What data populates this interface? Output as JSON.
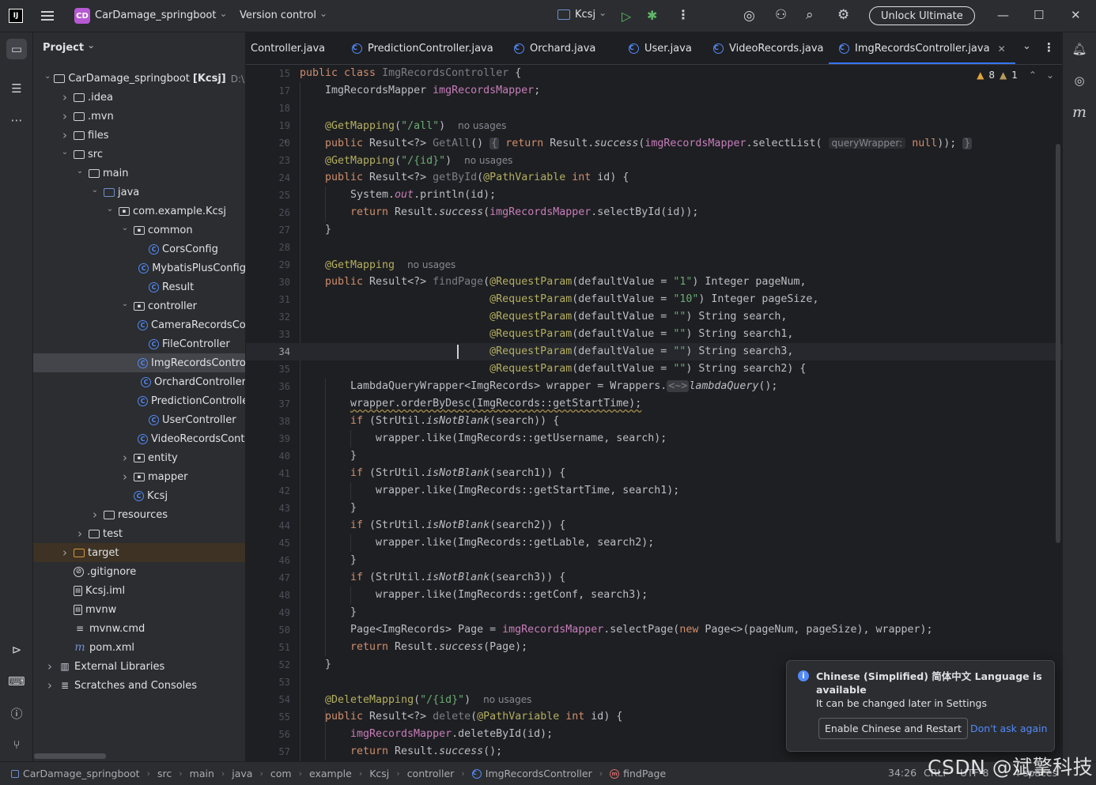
{
  "titlebar": {
    "logo": "IJ",
    "project_badge": "CD",
    "project_name": "CarDamage_springboot",
    "version_control": "Version control",
    "run_config": "Kcsj",
    "unlock": "Unlock Ultimate"
  },
  "project_panel": {
    "title": "Project",
    "tree": [
      {
        "label": "CarDamage_springboot",
        "suffix": "[Kcsj]",
        "hint": "D:\\未知",
        "depth": 0,
        "arrow": "open",
        "icon": "folder"
      },
      {
        "label": ".idea",
        "depth": 1,
        "arrow": "closed",
        "icon": "folder"
      },
      {
        "label": ".mvn",
        "depth": 1,
        "arrow": "closed",
        "icon": "folder"
      },
      {
        "label": "files",
        "depth": 1,
        "arrow": "closed",
        "icon": "folder"
      },
      {
        "label": "src",
        "depth": 1,
        "arrow": "open",
        "icon": "folder"
      },
      {
        "label": "main",
        "depth": 2,
        "arrow": "open",
        "icon": "folder"
      },
      {
        "label": "java",
        "depth": 3,
        "arrow": "open",
        "icon": "folder-blue"
      },
      {
        "label": "com.example.Kcsj",
        "depth": 4,
        "arrow": "open",
        "icon": "pkg"
      },
      {
        "label": "common",
        "depth": 5,
        "arrow": "open",
        "icon": "pkg"
      },
      {
        "label": "CorsConfig",
        "depth": 6,
        "arrow": "none",
        "icon": "cls"
      },
      {
        "label": "MybatisPlusConfig",
        "depth": 6,
        "arrow": "none",
        "icon": "cls"
      },
      {
        "label": "Result",
        "depth": 6,
        "arrow": "none",
        "icon": "cls"
      },
      {
        "label": "controller",
        "depth": 5,
        "arrow": "open",
        "icon": "pkg"
      },
      {
        "label": "CameraRecordsController",
        "depth": 6,
        "arrow": "none",
        "icon": "cls"
      },
      {
        "label": "FileController",
        "depth": 6,
        "arrow": "none",
        "icon": "cls"
      },
      {
        "label": "ImgRecordsController",
        "depth": 6,
        "arrow": "none",
        "icon": "cls",
        "selected": true
      },
      {
        "label": "OrchardController",
        "depth": 6,
        "arrow": "none",
        "icon": "cls"
      },
      {
        "label": "PredictionController",
        "depth": 6,
        "arrow": "none",
        "icon": "cls"
      },
      {
        "label": "UserController",
        "depth": 6,
        "arrow": "none",
        "icon": "cls"
      },
      {
        "label": "VideoRecordsController",
        "depth": 6,
        "arrow": "none",
        "icon": "cls"
      },
      {
        "label": "entity",
        "depth": 5,
        "arrow": "closed",
        "icon": "pkg"
      },
      {
        "label": "mapper",
        "depth": 5,
        "arrow": "closed",
        "icon": "pkg"
      },
      {
        "label": "Kcsj",
        "depth": 5,
        "arrow": "none",
        "icon": "cls"
      },
      {
        "label": "resources",
        "depth": 3,
        "arrow": "closed",
        "icon": "folder"
      },
      {
        "label": "test",
        "depth": 2,
        "arrow": "closed",
        "icon": "folder"
      },
      {
        "label": "target",
        "depth": 1,
        "arrow": "closed",
        "icon": "folder-orange",
        "excluded": true
      },
      {
        "label": ".gitignore",
        "depth": 1,
        "arrow": "none",
        "icon": "ignore"
      },
      {
        "label": "Kcsj.iml",
        "depth": 1,
        "arrow": "none",
        "icon": "file"
      },
      {
        "label": "mvnw",
        "depth": 1,
        "arrow": "none",
        "icon": "file"
      },
      {
        "label": "mvnw.cmd",
        "depth": 1,
        "arrow": "none",
        "icon": "text"
      },
      {
        "label": "pom.xml",
        "depth": 1,
        "arrow": "none",
        "icon": "maven"
      },
      {
        "label": "External Libraries",
        "depth": 0,
        "arrow": "closed",
        "icon": "lib"
      },
      {
        "label": "Scratches and Consoles",
        "depth": 0,
        "arrow": "closed",
        "icon": "scratch"
      }
    ]
  },
  "tabs": [
    {
      "label": "Controller.java",
      "icon": false
    },
    {
      "label": "PredictionController.java",
      "icon": true
    },
    {
      "label": "Orchard.java",
      "icon": true
    },
    {
      "label": "User.java",
      "icon": true
    },
    {
      "label": "VideoRecords.java",
      "icon": true
    },
    {
      "label": "ImgRecordsController.java",
      "icon": true,
      "active": true
    }
  ],
  "inspections": {
    "warnings": "8",
    "weak_warnings": "1"
  },
  "editor": {
    "current_line": "34",
    "lines": [
      {
        "n": "15",
        "html": "<span class=\"kw\">public class</span> <span class=\"unused\">ImgRecordsController</span> {",
        "indent": 0
      },
      {
        "n": "17",
        "html": "ImgRecordsMapper <span class=\"fld\">imgRecordsMapper</span>;",
        "indent": 1
      },
      {
        "n": "18",
        "html": "",
        "indent": 0
      },
      {
        "n": "19",
        "html": "<span class=\"ann\">@GetMapping</span>(<span class=\"str\">\"/all\"</span>)  <span class=\"hint\">no usages</span>",
        "indent": 1
      },
      {
        "n": "20",
        "html": "<span class=\"kw\">public</span> Result&lt;?&gt; <span class=\"unused\">GetAll</span>() <span class=\"fold-box\">{</span> <span class=\"kw\">return</span> Result.<span class=\"it\">success</span>(<span class=\"fld\">imgRecordsMapper</span>.selectList( <span class=\"inlay\">queryWrapper:</span> <span class=\"kw\">null</span>)); <span class=\"fold-box\">}</span>",
        "indent": 1,
        "fold": true
      },
      {
        "n": "23",
        "html": "<span class=\"ann\">@GetMapping</span>(<span class=\"str\">\"/{id}\"</span>)  <span class=\"hint\">no usages</span>",
        "indent": 1
      },
      {
        "n": "24",
        "html": "<span class=\"kw\">public</span> Result&lt;?&gt; <span class=\"unused\">getById</span>(<span class=\"ann\">@PathVariable</span> <span class=\"kw\">int</span> id) {",
        "indent": 1
      },
      {
        "n": "25",
        "html": "System.<span class=\"fld it\">out</span>.println(id);",
        "indent": 2
      },
      {
        "n": "26",
        "html": "<span class=\"kw\">return</span> Result.<span class=\"it\">success</span>(<span class=\"fld\">imgRecordsMapper</span>.selectById(id));",
        "indent": 2
      },
      {
        "n": "27",
        "html": "}",
        "indent": 1
      },
      {
        "n": "28",
        "html": "",
        "indent": 0
      },
      {
        "n": "29",
        "html": "<span class=\"ann\">@GetMapping</span>  <span class=\"hint\">no usages</span>",
        "indent": 1
      },
      {
        "n": "30",
        "html": "<span class=\"kw\">public</span> Result&lt;?&gt; <span class=\"unused\">findPage</span>(<span class=\"ann\">@RequestParam</span>(defaultValue = <span class=\"str\">\"1\"</span>) Integer pageNum,",
        "indent": 1
      },
      {
        "n": "31",
        "html": "                          <span class=\"ann\">@RequestParam</span>(defaultValue = <span class=\"str\">\"10\"</span>) Integer pageSize,",
        "indent": 1
      },
      {
        "n": "32",
        "html": "                          <span class=\"ann\">@RequestParam</span>(defaultValue = <span class=\"str\">\"\"</span>) String search,",
        "indent": 1
      },
      {
        "n": "33",
        "html": "                          <span class=\"ann\">@RequestParam</span>(defaultValue = <span class=\"str\">\"\"</span>) String search1,",
        "indent": 1
      },
      {
        "n": "34",
        "html": "                          <span class=\"ann\">@RequestParam</span>(defaultValue = <span class=\"str\">\"\"</span>) String search3,",
        "indent": 1
      },
      {
        "n": "35",
        "html": "                          <span class=\"ann\">@RequestParam</span>(defaultValue = <span class=\"str\">\"\"</span>) String search2) {",
        "indent": 1
      },
      {
        "n": "36",
        "html": "LambdaQueryWrapper&lt;ImgRecords&gt; wrapper = Wrappers.<span class=\"fold-box\">&lt;~&gt;</span><span class=\"it\">lambdaQuery</span>();",
        "indent": 2
      },
      {
        "n": "37",
        "html": "<span class=\"wavy\">wrapper.orderByDesc(ImgRecords::getStartTime);</span>",
        "indent": 2
      },
      {
        "n": "38",
        "html": "<span class=\"kw\">if</span> (StrUtil.<span class=\"it\">isNotBlank</span>(search)) {",
        "indent": 2
      },
      {
        "n": "39",
        "html": "wrapper.like(ImgRecords::getUsername, search);",
        "indent": 3
      },
      {
        "n": "40",
        "html": "}",
        "indent": 2
      },
      {
        "n": "41",
        "html": "<span class=\"kw\">if</span> (StrUtil.<span class=\"it\">isNotBlank</span>(search1)) {",
        "indent": 2
      },
      {
        "n": "42",
        "html": "wrapper.like(ImgRecords::getStartTime, search1);",
        "indent": 3
      },
      {
        "n": "43",
        "html": "}",
        "indent": 2
      },
      {
        "n": "44",
        "html": "<span class=\"kw\">if</span> (StrUtil.<span class=\"it\">isNotBlank</span>(search2)) {",
        "indent": 2
      },
      {
        "n": "45",
        "html": "wrapper.like(ImgRecords::getLable, search2);",
        "indent": 3
      },
      {
        "n": "46",
        "html": "}",
        "indent": 2
      },
      {
        "n": "47",
        "html": "<span class=\"kw\">if</span> (StrUtil.<span class=\"it\">isNotBlank</span>(search3)) {",
        "indent": 2
      },
      {
        "n": "48",
        "html": "wrapper.like(ImgRecords::getConf, search3);",
        "indent": 3
      },
      {
        "n": "49",
        "html": "}",
        "indent": 2
      },
      {
        "n": "50",
        "html": "Page&lt;ImgRecords&gt; Page = <span class=\"fld\">imgRecordsMapper</span>.selectPage(<span class=\"kw\">new</span> Page&lt;&gt;(pageNum, pageSize), wrapper);",
        "indent": 2
      },
      {
        "n": "51",
        "html": "<span class=\"kw\">return</span> Result.<span class=\"it\">success</span>(Page);",
        "indent": 2
      },
      {
        "n": "52",
        "html": "}",
        "indent": 1
      },
      {
        "n": "53",
        "html": "",
        "indent": 0
      },
      {
        "n": "54",
        "html": "<span class=\"ann\">@DeleteMapping</span>(<span class=\"str\">\"/{id}\"</span>)  <span class=\"hint\">no usages</span>",
        "indent": 1
      },
      {
        "n": "55",
        "html": "<span class=\"kw\">public</span> Result&lt;?&gt; <span class=\"unused\">delete</span>(<span class=\"ann\">@PathVariable</span> <span class=\"kw\">int</span> id) {",
        "indent": 1
      },
      {
        "n": "56",
        "html": "<span class=\"fld\">imgRecordsMapper</span>.deleteById(id);",
        "indent": 2
      },
      {
        "n": "57",
        "html": "<span class=\"kw\">return</span> Result.<span class=\"it\">success</span>();",
        "indent": 2
      }
    ]
  },
  "notification": {
    "title": "Chinese (Simplified) 简体中文 Language is available",
    "body": "It can be changed later in Settings",
    "button": "Enable Chinese and Restart",
    "link": "Don't ask again"
  },
  "statusbar": {
    "breadcrumbs": [
      "CarDamage_springboot",
      "src",
      "main",
      "java",
      "com",
      "example",
      "Kcsj",
      "controller",
      "ImgRecordsController",
      "findPage"
    ],
    "position": "34:26",
    "line_sep": "CRLF",
    "encoding": "UTF-8",
    "indent": "4 spaces"
  },
  "watermark": "CSDN @斌擎科技"
}
